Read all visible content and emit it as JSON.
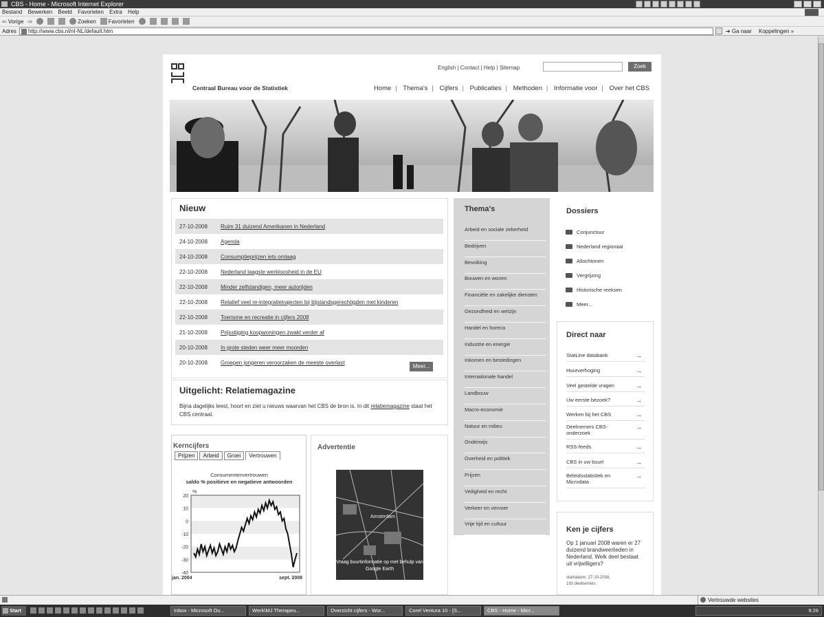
{
  "window": {
    "title": "CBS - Home - Microsoft Internet Explorer"
  },
  "menu": [
    "Bestand",
    "Bewerken",
    "Beeld",
    "Favorieten",
    "Extra",
    "Help"
  ],
  "toolbar": {
    "back": "Vorige",
    "search": "Zoeken",
    "favorites": "Favorieten"
  },
  "address": {
    "label": "Adres",
    "url": "http://www.cbs.nl/nl-NL/default.htm",
    "go": "Ga naar",
    "links": "Koppelingen"
  },
  "header": {
    "org_name": "Centraal Bureau voor de Statistiek",
    "utility": "English | Contact | Help | Sitemap",
    "search_button": "Zoek",
    "nav": [
      "Home",
      "Thema's",
      "Cijfers",
      "Publicaties",
      "Methoden",
      "Informatie voor",
      "Over het CBS"
    ]
  },
  "nieuw": {
    "title": "Nieuw",
    "items": [
      {
        "date": "27-10-2008",
        "title": "Ruim 31 duizend Amerikanen in Nederland"
      },
      {
        "date": "24-10-2008",
        "title": "Agenda"
      },
      {
        "date": "24-10-2008",
        "title": "Consumptieprijzen iets omlaag"
      },
      {
        "date": "22-10-2008",
        "title": "Nederland laagste werkloosheid in de EU"
      },
      {
        "date": "22-10-2008",
        "title": "Minder zelfstandigen, meer autorijden"
      },
      {
        "date": "22-10-2008",
        "title": "Relatief veel re-integratietrajecten bij bijstandsgerechtigden met kinderen"
      },
      {
        "date": "22-10-2008",
        "title": "Toerisme en recreatie in cijfers 2008"
      },
      {
        "date": "21-10-2008",
        "title": "Prijsstijging koopwoningen zwakt verder af"
      },
      {
        "date": "20-10-2008",
        "title": "In grote steden weer meer moorden"
      },
      {
        "date": "20-10-2008",
        "title": "Groepen jongeren veroorzaken de meeste overlast"
      }
    ],
    "more": "Meer..."
  },
  "uitgelicht": {
    "title": "Uitgelicht: Relatiemagazine",
    "text_before": "Bijna dagelijks leest, hoort en ziet u nieuws waarvan het CBS de bron is. In dit ",
    "link": "relatiemagazine",
    "text_after": " staat het CBS centraal."
  },
  "kerncijfers": {
    "title": "Kerncijfers",
    "tabs": [
      "Prijzen",
      "Arbeid",
      "Groei",
      "Vertrouwen"
    ],
    "active_tab": "Vertrouwen",
    "chart_title": "Consumentenvertrouwen",
    "chart_subtitle": "saldo % positieve en negatieve antwoorden"
  },
  "chart_data": {
    "type": "line",
    "title": "Consumentenvertrouwen",
    "subtitle": "saldo % positieve en negatieve antwoorden",
    "ylabel": "%",
    "ylim": [
      -40,
      20
    ],
    "yticks": [
      20,
      10,
      0,
      -10,
      -20,
      -30,
      -40
    ],
    "x_start_label": "jan. 2004",
    "x_end_label": "sept. 2008",
    "series": [
      {
        "values": [
          -25,
          -28,
          -22,
          -26,
          -18,
          -24,
          -20,
          -27,
          -23,
          -19,
          -25,
          -21,
          -27,
          -24,
          -18,
          -22,
          -26,
          -20,
          -24,
          -17,
          -22,
          -19,
          -24,
          -21,
          -15,
          -10,
          -5,
          -8,
          -3,
          2,
          -2,
          4,
          1,
          7,
          3,
          9,
          6,
          12,
          8,
          14,
          10,
          16,
          12,
          15,
          9,
          11,
          5,
          7,
          0,
          2,
          -6,
          -10,
          -18,
          -26,
          -36,
          -30,
          -25
        ]
      }
    ]
  },
  "advertentie": {
    "title": "Advertentie",
    "caption": "Vraag buurtinformatie op met behulp van Google Earth",
    "map_label": "Amsterdam"
  },
  "themas": {
    "title": "Thema's",
    "items": [
      "Arbeid en sociale zekerheid",
      "Bedrijven",
      "Bevolking",
      "Bouwen en wonen",
      "Financiële en zakelijke diensten",
      "Gezondheid en welzijn",
      "Handel en horeca",
      "Industrie en energie",
      "Inkomen en bestedingen",
      "Internationale handel",
      "Landbouw",
      "Macro-economie",
      "Natuur en milieu",
      "Onderwijs",
      "Overheid en politiek",
      "Prijzen",
      "Veiligheid en recht",
      "Verkeer en vervoer",
      "Vrije tijd en cultuur"
    ]
  },
  "dossiers": {
    "title": "Dossiers",
    "items": [
      "Conjunctuur",
      "Nederland regionaal",
      "Allochtonen",
      "Vergrijzing",
      "Historische reeksen",
      "Meer..."
    ]
  },
  "direct_naar": {
    "title": "Direct naar",
    "items": [
      "StatLine databank",
      "Huurverhoging",
      "Veel gestelde vragen",
      "Uw eerste bezoek?",
      "Werken bij het CBS",
      "Deelnemers CBS-onderzoek",
      "RSS-feeds",
      "CBS in uw buurt",
      "Beleidsstatistiek en Microdata"
    ]
  },
  "ken_je_cijfers": {
    "title": "Ken je cijfers",
    "text": "Op 1 januari 2008 waren er 27 duizend brandweerlieden in Nederland. Welk deel bestaat uit vrijwilligers?",
    "date": "startdatum: 27-10-2008,",
    "count": "193 deelnemers"
  },
  "statusbar": {
    "zone": "Vertrouwde websites"
  },
  "taskbar": {
    "start": "Start",
    "items": [
      "Inbox - Microsoft Ou...",
      "Werk\\MJ Therapeu...",
      "Overzicht cijfers - Wor...",
      "Corel Ventura 10 - [S...",
      "CBS - Home - Micr..."
    ],
    "clock": "9:26"
  }
}
